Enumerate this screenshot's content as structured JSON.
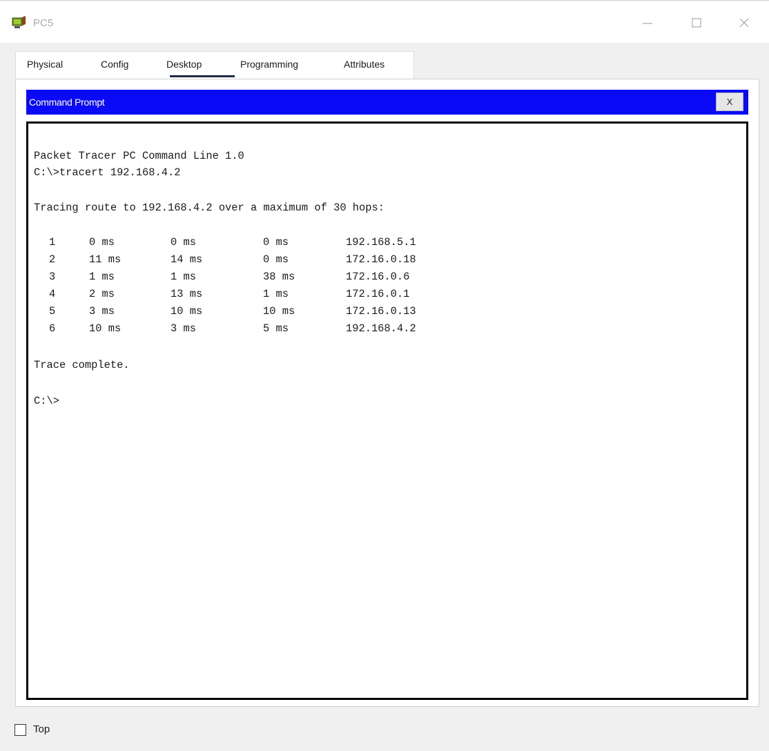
{
  "window": {
    "title": "PC5",
    "icon": "pc-icon"
  },
  "window_controls": {
    "minimize": "minimize-icon",
    "maximize": "maximize-icon",
    "close": "close-icon"
  },
  "tabs": [
    {
      "label": "Physical",
      "active": false
    },
    {
      "label": "Config",
      "active": false
    },
    {
      "label": "Desktop",
      "active": true
    },
    {
      "label": "Programming",
      "active": false
    },
    {
      "label": "Attributes",
      "active": false
    }
  ],
  "command_prompt": {
    "title": "Command Prompt",
    "close_label": "X",
    "header_color": "#0a0af7"
  },
  "terminal": {
    "banner": "Packet Tracer PC Command Line 1.0",
    "command": "C:\\>tracert 192.168.4.2",
    "tracing": "Tracing route to 192.168.4.2 over a maximum of 30 hops:",
    "hops": [
      {
        "hop": "1",
        "t1": "0 ms",
        "t2": "0 ms",
        "t3": "0 ms",
        "ip": "192.168.5.1"
      },
      {
        "hop": "2",
        "t1": "11 ms",
        "t2": "14 ms",
        "t3": "0 ms",
        "ip": "172.16.0.18"
      },
      {
        "hop": "3",
        "t1": "1 ms",
        "t2": "1 ms",
        "t3": "38 ms",
        "ip": "172.16.0.6"
      },
      {
        "hop": "4",
        "t1": "2 ms",
        "t2": "13 ms",
        "t3": "1 ms",
        "ip": "172.16.0.1"
      },
      {
        "hop": "5",
        "t1": "3 ms",
        "t2": "10 ms",
        "t3": "10 ms",
        "ip": "172.16.0.13"
      },
      {
        "hop": "6",
        "t1": "10 ms",
        "t2": "3 ms",
        "t3": "5 ms",
        "ip": "192.168.4.2"
      }
    ],
    "complete": "Trace complete.",
    "prompt": "C:\\>"
  },
  "footer": {
    "top_label": "Top",
    "top_checked": false
  }
}
